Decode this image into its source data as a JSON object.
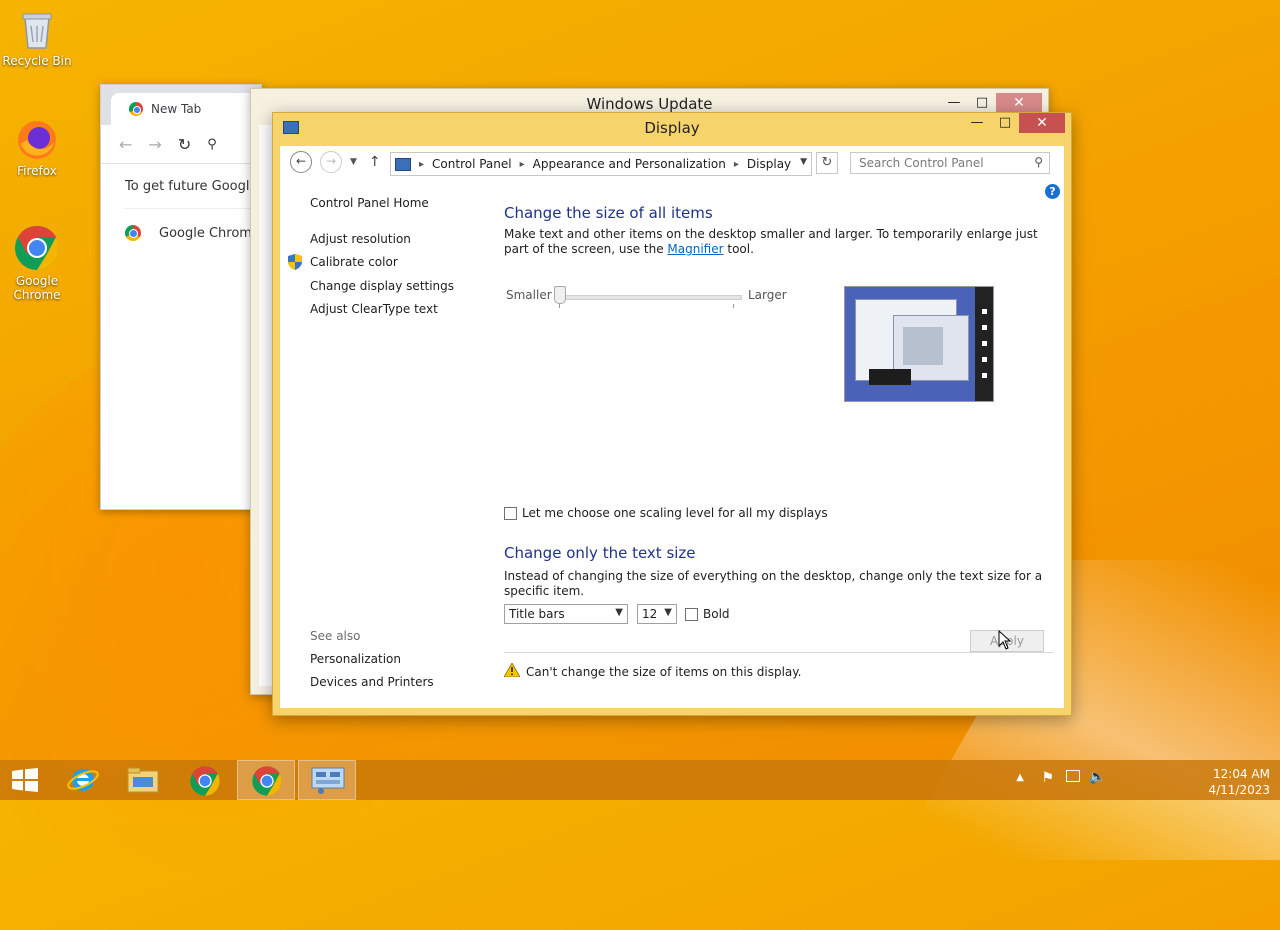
{
  "desktop": {
    "icons": [
      {
        "label": "Recycle Bin"
      },
      {
        "label": "Firefox"
      },
      {
        "label": "Google Chrome"
      }
    ]
  },
  "chrome": {
    "tab_label": "New Tab",
    "message": "To get future Google C",
    "row_label": "Google Chrome"
  },
  "windows_update": {
    "title": "Windows Update"
  },
  "display_window": {
    "title": "Display",
    "breadcrumb": [
      "Control Panel",
      "Appearance and Personalization",
      "Display"
    ],
    "search_placeholder": "Search Control Panel",
    "left_nav": {
      "home": "Control Panel Home",
      "items": [
        "Adjust resolution",
        "Calibrate color",
        "Change display settings",
        "Adjust ClearType text"
      ],
      "see_also_heading": "See also",
      "see_also": [
        "Personalization",
        "Devices and Printers"
      ]
    },
    "size_section": {
      "heading": "Change the size of all items",
      "desc_before": "Make text and other items on the desktop smaller and larger. To temporarily enlarge just part of the screen, use the ",
      "desc_link": "Magnifier",
      "desc_after": " tool.",
      "smaller_label": "Smaller",
      "larger_label": "Larger",
      "slider_value": 0
    },
    "scaling_checkbox_label": "Let me choose one scaling level for all my displays",
    "text_section": {
      "heading": "Change only the text size",
      "desc": "Instead of changing the size of everything on the desktop, change only the text size for a specific item.",
      "item_select": "Title bars",
      "size_select": "12",
      "bold_label": "Bold"
    },
    "warning": "Can't change the size of items on this display.",
    "apply_label": "Apply"
  },
  "taskbar": {
    "time": "12:04 AM",
    "date": "4/11/2023"
  },
  "colors": {
    "heading": "#1e3287",
    "link": "#0066cc",
    "title_bar": "#f7d36b",
    "close_button": "#c75050"
  }
}
